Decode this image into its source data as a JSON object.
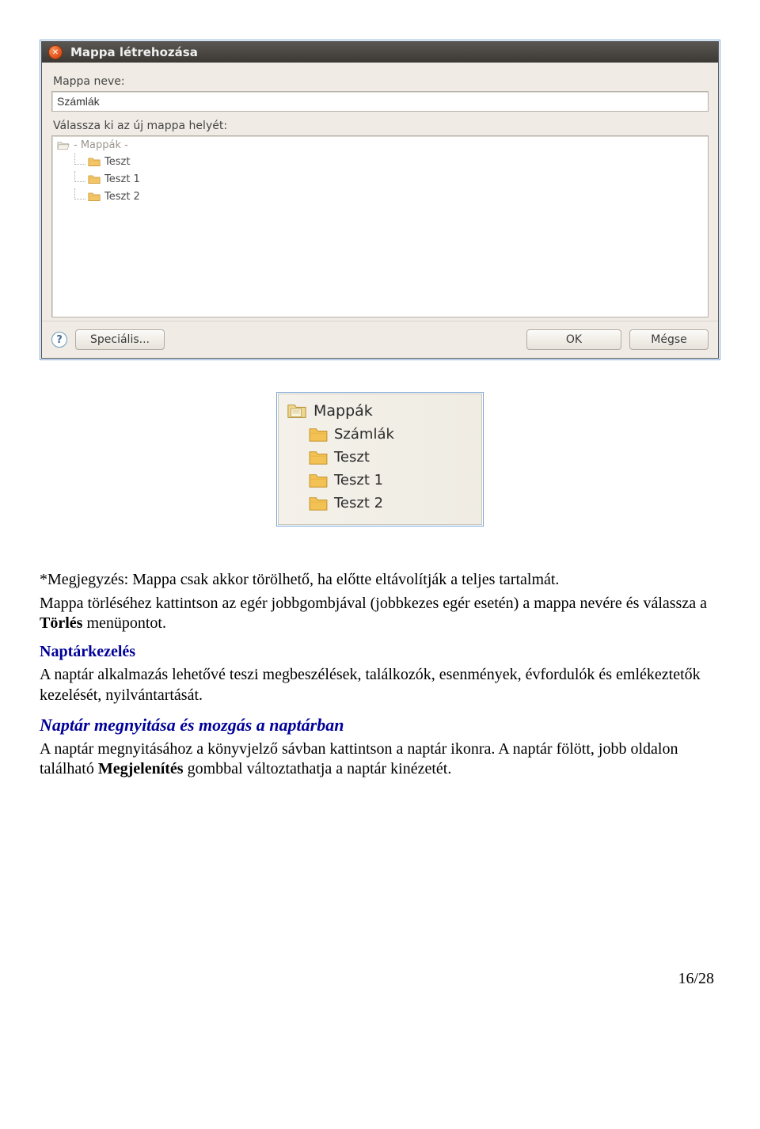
{
  "dialog": {
    "title": "Mappa létrehozása",
    "close_glyph": "✕",
    "label_name": "Mappa neve:",
    "name_value": "Számlák",
    "label_location": "Válassza ki az új mappa helyét:",
    "root": "- Mappák -",
    "items": [
      "Teszt",
      "Teszt 1",
      "Teszt 2"
    ],
    "help_glyph": "?",
    "btn_special": "Speciális...",
    "btn_ok": "OK",
    "btn_cancel": "Mégse"
  },
  "panel": {
    "header": "Mappák",
    "items": [
      "Számlák",
      "Teszt",
      "Teszt 1",
      "Teszt 2"
    ]
  },
  "text": {
    "note": "*Megjegyzés: Mappa csak akkor törölhető, ha előtte eltávolítják a teljes tartalmát.",
    "para1a": "Mappa törléséhez kattintson az egér jobbgombjával (jobbkezes egér esetén) a mappa nevére és válassza a ",
    "para1b": "Törlés",
    "para1c": " menüpontot.",
    "h1": "Naptárkezelés",
    "para2": "A naptár alkalmazás lehetővé teszi megbeszélések, találkozók, esenmények, évfordulók és emlékeztetők kezelését, nyilvántartását.",
    "h2": "Naptár megnyitása és mozgás a naptárban",
    "para3a": "A naptár megnyitásához a könyvjelző sávban kattintson a naptár ikonra. A naptár fölött, jobb oldalon található ",
    "para3b": "Megjelenítés",
    "para3c": " gombbal változtathatja a naptár kinézetét."
  },
  "pagenum": "16/28"
}
